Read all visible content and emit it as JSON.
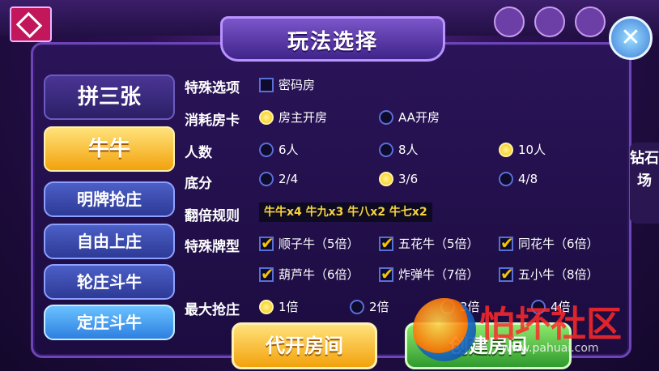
{
  "dialog": {
    "title": "玩法选择",
    "close_icon": "close-icon"
  },
  "sidebar": {
    "items": [
      {
        "label": "拼三张",
        "state": "normal"
      },
      {
        "label": "牛牛",
        "state": "selected"
      },
      {
        "label": "明牌抢庄",
        "state": "normal"
      },
      {
        "label": "自由上庄",
        "state": "normal"
      },
      {
        "label": "轮庄斗牛",
        "state": "normal"
      },
      {
        "label": "定庄斗牛",
        "state": "active"
      }
    ]
  },
  "right_tab": {
    "label": "钻石场"
  },
  "settings": {
    "special_options": {
      "label": "特殊选项",
      "password_room": {
        "label": "密码房",
        "checked": false
      }
    },
    "room_card": {
      "label": "消耗房卡",
      "options": [
        {
          "label": "房主开房",
          "selected": true
        },
        {
          "label": "AA开房",
          "selected": false
        }
      ]
    },
    "players": {
      "label": "人数",
      "options": [
        {
          "label": "6人",
          "selected": false
        },
        {
          "label": "8人",
          "selected": false
        },
        {
          "label": "10人",
          "selected": true
        }
      ]
    },
    "base_score": {
      "label": "底分",
      "options": [
        {
          "label": "2/4",
          "selected": false
        },
        {
          "label": "3/6",
          "selected": true
        },
        {
          "label": "4/8",
          "selected": false
        }
      ]
    },
    "multiplier_rule": {
      "label": "翻倍规则",
      "value": "牛牛x4 牛九x3 牛八x2 牛七x2"
    },
    "special_hands": {
      "label": "特殊牌型",
      "options": [
        {
          "label": "顺子牛（5倍）",
          "checked": true
        },
        {
          "label": "五花牛（5倍）",
          "checked": true
        },
        {
          "label": "同花牛（6倍）",
          "checked": true
        },
        {
          "label": "葫芦牛（6倍）",
          "checked": true
        },
        {
          "label": "炸弹牛（7倍）",
          "checked": true
        },
        {
          "label": "五小牛（8倍）",
          "checked": true
        }
      ]
    },
    "max_bid": {
      "label": "最大抢庄",
      "options": [
        {
          "label": "1倍",
          "selected": true
        },
        {
          "label": "2倍",
          "selected": false
        },
        {
          "label": "3倍",
          "selected": false
        },
        {
          "label": "4倍",
          "selected": false
        }
      ]
    }
  },
  "buttons": {
    "proxy_open": "代开房间",
    "create_room": "创建房间"
  },
  "watermark": {
    "text": "怕坏社区",
    "url": "www.pahuai.com"
  },
  "colors": {
    "gold": "#f7c400",
    "panel": "#2a1458",
    "accent_blue": "#2e7fe0"
  }
}
